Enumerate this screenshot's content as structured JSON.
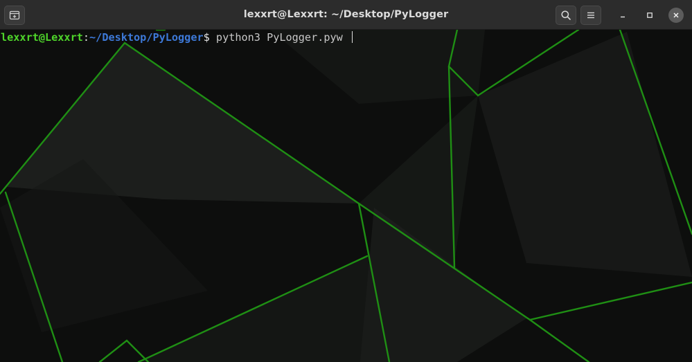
{
  "window": {
    "title": "lexxrt@Lexxrt: ~/Desktop/PyLogger",
    "icons": {
      "new_tab": "new-tab-icon",
      "search": "search-icon",
      "menu": "hamburger-menu-icon",
      "minimize": "minimize-icon",
      "maximize": "maximize-icon",
      "close": "close-icon"
    }
  },
  "terminal": {
    "user_host": "lexxrt@Lexxrt",
    "separator": ":",
    "path": "~/Desktop/PyLogger",
    "prompt_symbol": "$",
    "command": " python3 PyLogger.pyw "
  },
  "colors": {
    "user_host": "#4ed42a",
    "path": "#3d79d8",
    "titlebar": "#2c2c2c",
    "wallpaper_lines": "#1f8f14"
  }
}
